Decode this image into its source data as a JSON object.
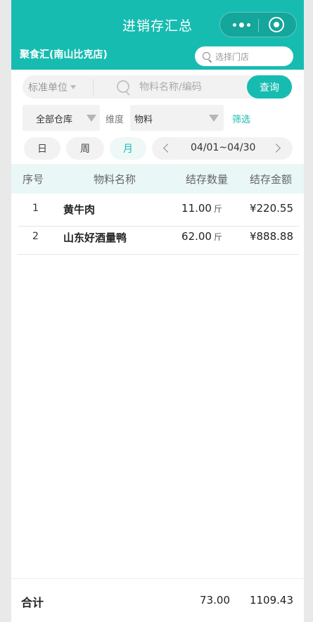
{
  "header": {
    "title": "进销存汇总",
    "store_name": "聚食汇(南山比克店)",
    "store_select_placeholder": "选择门店",
    "colors": {
      "accent": "#17bcb1"
    }
  },
  "search": {
    "unit_label": "标准单位",
    "placeholder": "物料名称/编码",
    "query_label": "查询"
  },
  "filters": {
    "warehouse": "全部仓库",
    "dimension_label": "维度",
    "dimension_value": "物料",
    "filter_label": "筛选"
  },
  "period": {
    "day": "日",
    "week": "周",
    "month": "月",
    "selected": "月",
    "range": "04/01~04/30"
  },
  "table": {
    "headers": [
      "序号",
      "物料名称",
      "结存数量",
      "结存金额"
    ],
    "rows": [
      {
        "index": "1",
        "name": "黄牛肉",
        "qty": "11.00",
        "unit": "斤",
        "amount": "¥220.55"
      },
      {
        "index": "2",
        "name": "山东好酒量鸭",
        "qty": "62.00",
        "unit": "斤",
        "amount": "¥888.88"
      }
    ]
  },
  "footer": {
    "label": "合计",
    "total_qty": "73.00",
    "total_amount": "1109.43"
  }
}
